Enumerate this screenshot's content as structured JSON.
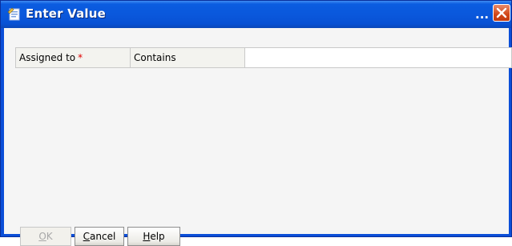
{
  "window": {
    "title": "Enter Value",
    "title_ellipsis": "...",
    "icons": {
      "app": "dialog-app-icon",
      "close": "close-icon"
    },
    "colors": {
      "titlebar": "#0b5ce0",
      "close": "#d24719",
      "required": "#e00000"
    }
  },
  "criteria": {
    "field_label": "Assigned to",
    "required_marker": "*",
    "operator": "Contains",
    "value": "",
    "placeholder": ""
  },
  "buttons": {
    "ok": {
      "mnemonic": "O",
      "rest": "K",
      "enabled": false
    },
    "cancel": {
      "mnemonic": "C",
      "rest": "ancel",
      "enabled": true
    },
    "help": {
      "mnemonic": "H",
      "rest": "elp",
      "enabled": true
    }
  }
}
